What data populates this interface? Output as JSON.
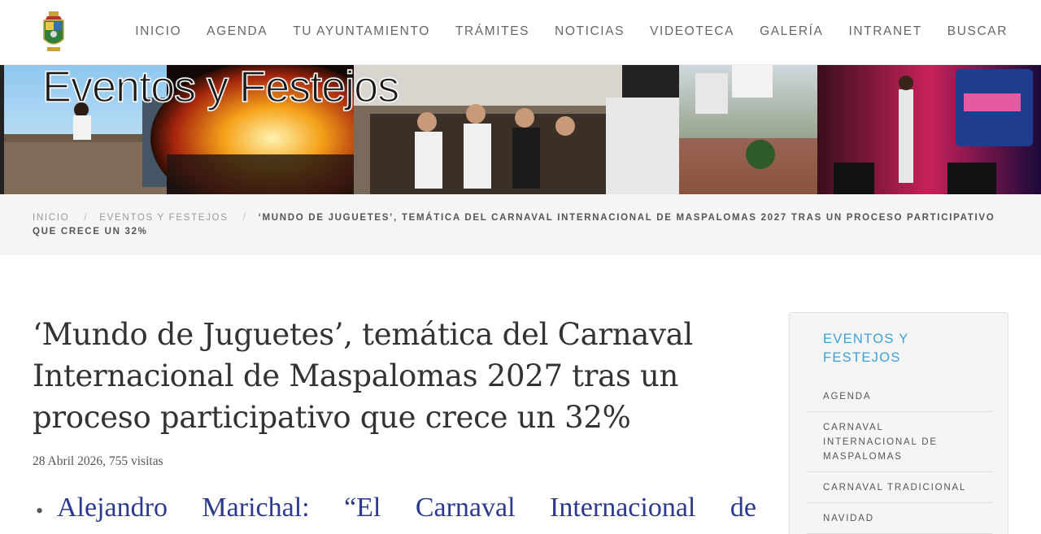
{
  "header": {
    "nav": [
      "INICIO",
      "AGENDA",
      "TU AYUNTAMIENTO",
      "TRÁMITES",
      "NOTICIAS",
      "VIDEOTECA",
      "GALERÍA",
      "INTRANET",
      "BUSCAR"
    ]
  },
  "banner": {
    "title": "Eventos y Festejos",
    "icon": "event-photo-collage"
  },
  "breadcrumb": {
    "home": "INICIO",
    "section": "EVENTOS Y FESTEJOS",
    "current": "‘MUNDO DE JUGUETES’, TEMÁTICA DEL CARNAVAL INTERNACIONAL DE MASPALOMAS 2027 TRAS UN PROCESO PARTICIPATIVO QUE CRECE UN 32%",
    "separator": "/"
  },
  "article": {
    "title": "‘Mundo de Juguetes’, temática del Carnaval Internacional de Maspalomas 2027 tras un proceso participativo que crece un 32%",
    "meta": "28 Abril 2026, 755 visitas",
    "lead_words": [
      "Alejandro",
      "Marichal:",
      "“El",
      "Carnaval",
      "Internacional",
      "de"
    ]
  },
  "sidebar": {
    "title": "EVENTOS Y FESTEJOS",
    "items": [
      "AGENDA",
      "CARNAVAL INTERNACIONAL DE MASPALOMAS",
      "CARNAVAL TRADICIONAL",
      "NAVIDAD"
    ]
  },
  "colors": {
    "accent": "#3aa0d9",
    "link": "#2b3a8f",
    "breadcrumb_bg": "#f5f5f5"
  }
}
